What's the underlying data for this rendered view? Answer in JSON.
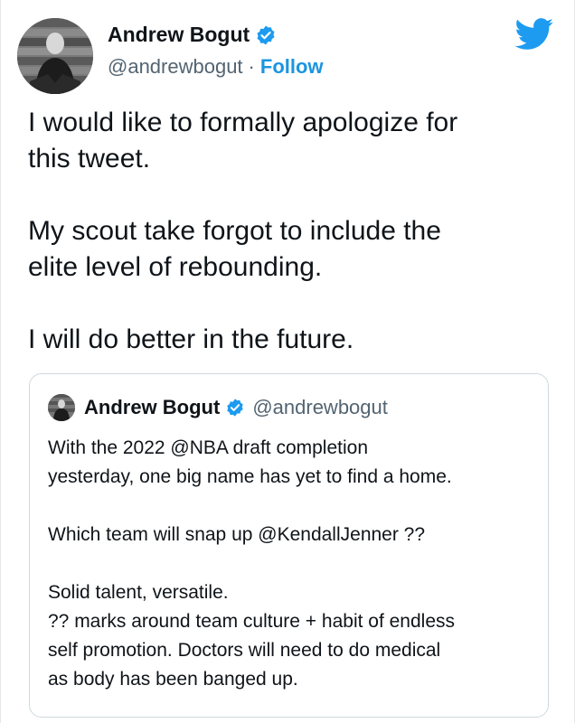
{
  "author": {
    "name": "Andrew Bogut",
    "handle": "@andrewbogut",
    "separator": "·",
    "follow_label": "Follow"
  },
  "tweet": {
    "lines": [
      "I would like to formally apologize for",
      "this tweet.",
      "",
      "My scout take forgot to include the",
      "elite level of rebounding.",
      "",
      "I will do better in the future."
    ]
  },
  "quoted": {
    "name": "Andrew Bogut",
    "handle": "@andrewbogut",
    "lines": [
      "With the 2022 @NBA draft completion",
      "yesterday, one big name has yet to find a home.",
      "",
      "Which team will snap up @KendallJenner ??",
      "",
      "Solid talent, versatile.",
      "?? marks around team culture + habit of endless",
      "self promotion. Doctors will need to do medical",
      "as body has been banged up."
    ]
  },
  "colors": {
    "twitter_blue": "#1d9bf0",
    "text_primary": "#0f1419",
    "text_secondary": "#536471",
    "follow_blue": "#1b95e0",
    "border": "#cfd9de"
  },
  "icons": {
    "logo": "twitter-bird-icon",
    "verified": "verified-badge-icon"
  }
}
